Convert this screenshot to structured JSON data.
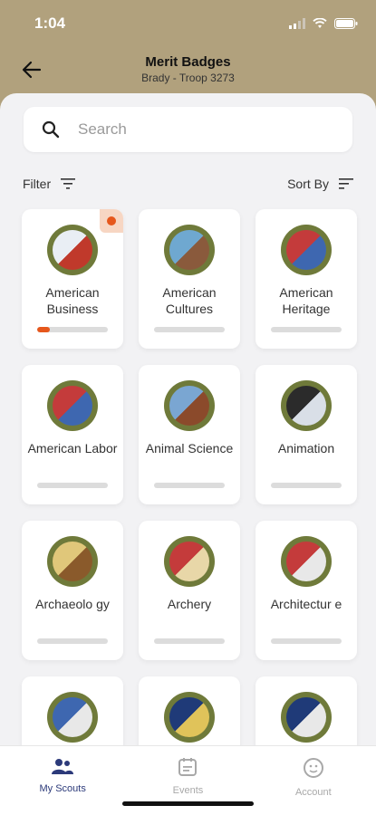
{
  "status": {
    "time": "1:04"
  },
  "header": {
    "title": "Merit Badges",
    "subtitle": "Brady - Troop 3273"
  },
  "search": {
    "placeholder": "Search"
  },
  "toolbar": {
    "filter_label": "Filter",
    "sort_label": "Sort By"
  },
  "badges": [
    {
      "label": "American Business",
      "progress": 0.18,
      "highlight": true,
      "colors": [
        "#e9eef4",
        "#c0392b"
      ]
    },
    {
      "label": "American Cultures",
      "progress": 0,
      "colors": [
        "#6fa8d0",
        "#8a5a3c"
      ]
    },
    {
      "label": "American Heritage",
      "progress": 0,
      "colors": [
        "#c43b3b",
        "#3e67b0"
      ]
    },
    {
      "label": "American Labor",
      "progress": 0,
      "colors": [
        "#c43b3b",
        "#3e67b0"
      ]
    },
    {
      "label": "Animal Science",
      "progress": 0,
      "colors": [
        "#7aa6d2",
        "#8b4a2b"
      ]
    },
    {
      "label": "Animation",
      "progress": 0,
      "colors": [
        "#2b2b2b",
        "#d9dfe7"
      ]
    },
    {
      "label": "Archaeolo gy",
      "progress": 0,
      "colors": [
        "#e0c77a",
        "#8a5a2b"
      ]
    },
    {
      "label": "Archery",
      "progress": 0,
      "colors": [
        "#c43b3b",
        "#e8d7a8"
      ]
    },
    {
      "label": "Architectur e",
      "progress": 0,
      "colors": [
        "#c43b3b",
        "#e8e8e8"
      ]
    },
    {
      "label": "",
      "progress": 0,
      "colors": [
        "#3e67b0",
        "#e8e8e8"
      ]
    },
    {
      "label": "",
      "progress": 0,
      "colors": [
        "#1f3a78",
        "#e0c35a"
      ]
    },
    {
      "label": "",
      "progress": 0,
      "colors": [
        "#1f3a78",
        "#e8e8e8"
      ]
    }
  ],
  "tabs": [
    {
      "label": "My Scouts",
      "active": true,
      "icon": "people-icon"
    },
    {
      "label": "Events",
      "active": false,
      "icon": "calendar-icon"
    },
    {
      "label": "Account",
      "active": false,
      "icon": "account-icon"
    }
  ],
  "colors": {
    "header": "#b1a17d",
    "accent": "#e6571c",
    "active_tab": "#2c3a7a"
  }
}
